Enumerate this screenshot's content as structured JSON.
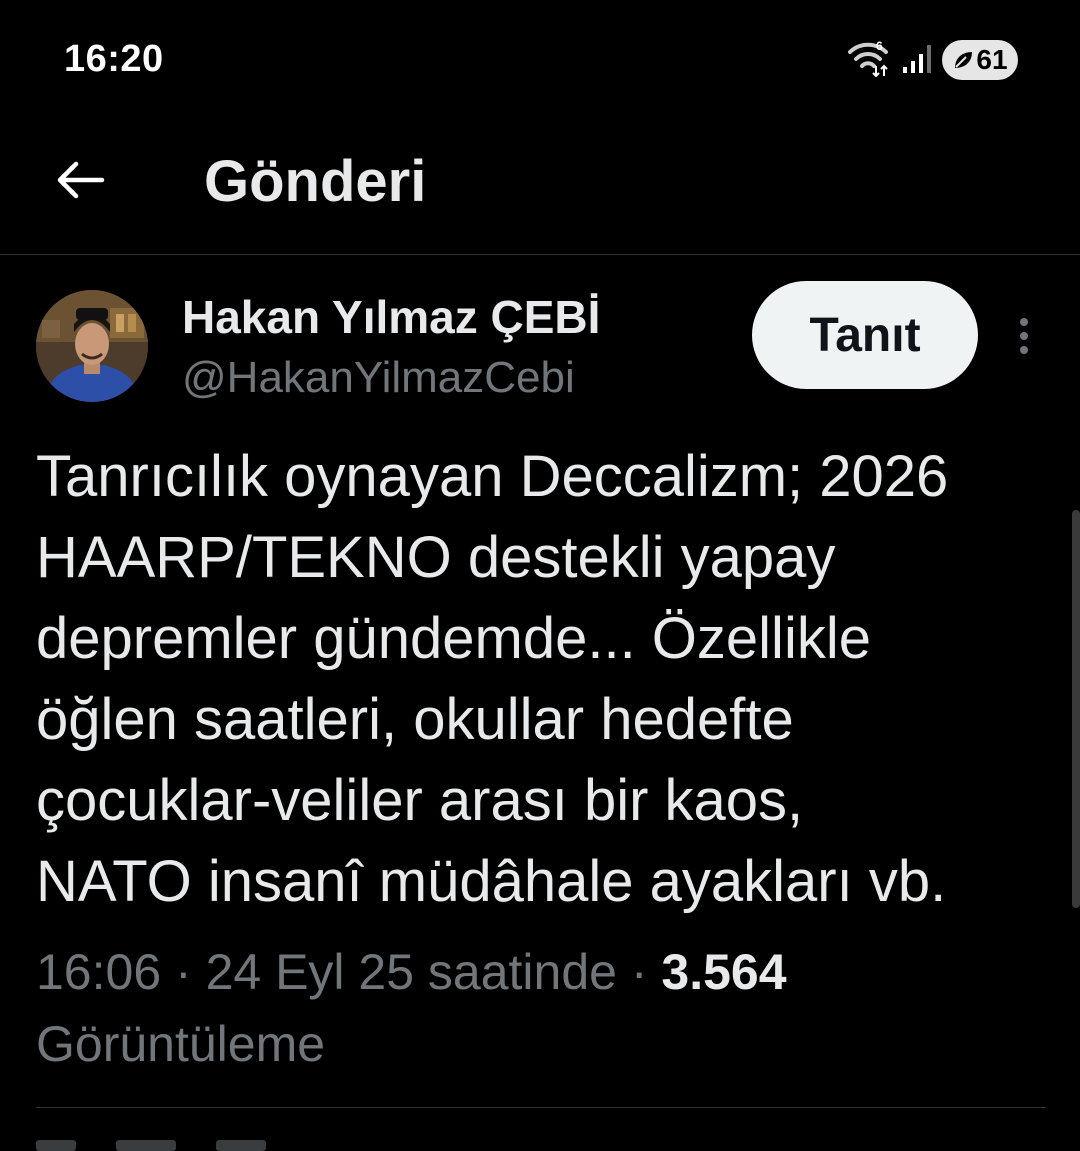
{
  "status_bar": {
    "time": "16:20",
    "battery": "61",
    "icons": [
      "wifi-icon",
      "signal-icon",
      "battery-icon"
    ]
  },
  "header": {
    "title": "Gönderi",
    "back_icon": "arrow-left-icon"
  },
  "tweet": {
    "author": {
      "display_name": "Hakan Yılmaz ÇEBİ",
      "handle": "@HakanYilmazCebi"
    },
    "follow_label": "Tanıt",
    "more_icon": "more-vertical-icon",
    "text_lines": [
      "Tanrıcılık oynayan Deccalizm; 2026",
      "HAARP/TEKNO destekli yapay",
      "depremler gündemde... Özellikle",
      "öğlen saatleri, okullar hedefte",
      "çocuklar-veliler arası bir kaos,",
      "NATO insanî müdâhale ayakları vb."
    ],
    "time": "16:06",
    "date": "24 Eyl 25 saatinde",
    "views_count": "3.564",
    "views_label": "Görüntüleme",
    "separator": " · "
  },
  "colors": {
    "background": "#000000",
    "text_primary": "#e7e9ea",
    "text_secondary": "#71767b",
    "divider": "#2f3336",
    "button_bg": "#eff3f4"
  }
}
